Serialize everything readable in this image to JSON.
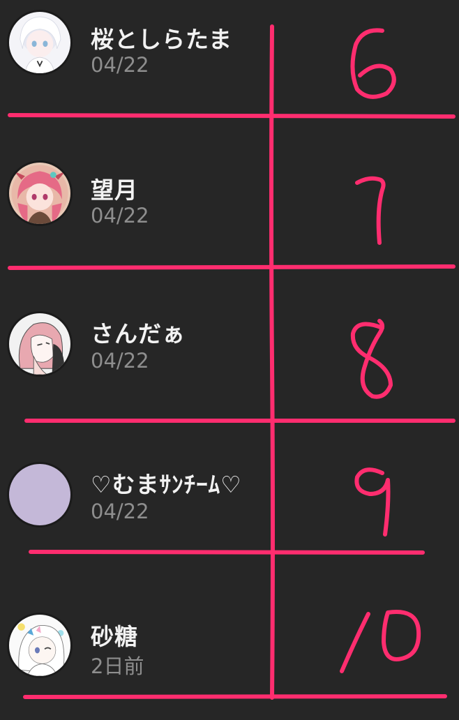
{
  "entries": [
    {
      "name": "桜としらたま",
      "date": "04/22",
      "rank": "6"
    },
    {
      "name": "望月",
      "date": "04/22",
      "rank": "7"
    },
    {
      "name": "さんだぁ",
      "date": "04/22",
      "rank": "8"
    },
    {
      "name": "♡むまｻﾝﾁｰﾑ♡",
      "date": "04/22",
      "rank": "9"
    },
    {
      "name": "砂糖",
      "date": "2日前",
      "rank": "10"
    }
  ],
  "colors": {
    "background": "#262626",
    "name_text": "#f2f2f2",
    "date_text": "#8e8e8e",
    "annotation": "#ff2d6f",
    "placeholder_avatar": "#c4b8d8"
  }
}
